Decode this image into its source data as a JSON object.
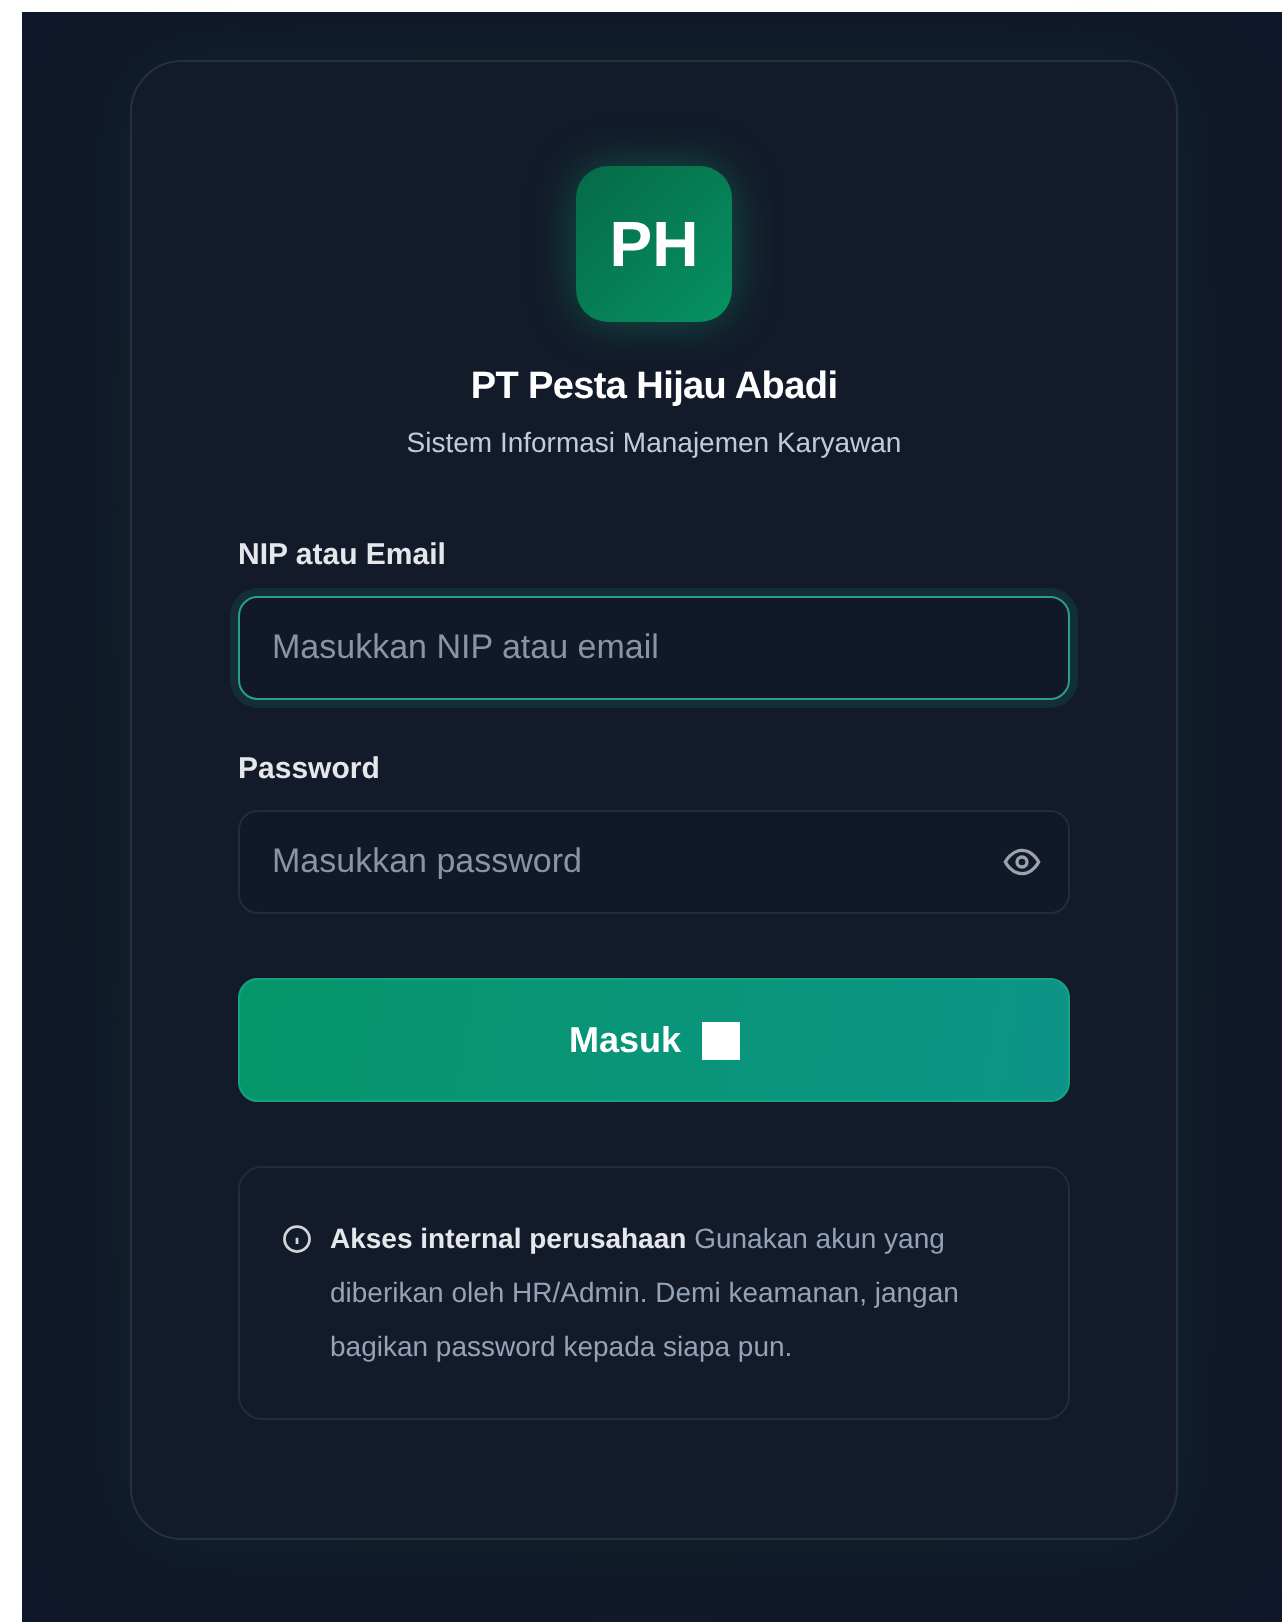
{
  "logo": {
    "initials": "PH"
  },
  "company": "PT Pesta Hijau Abadi",
  "subtitle": "Sistem Informasi Manajemen Karyawan",
  "fields": [
    {
      "label": "NIP atau Email",
      "placeholder": "Masukkan NIP atau email",
      "focused": true,
      "kind": "text"
    },
    {
      "label": "Password",
      "placeholder": "Masukkan password",
      "focused": false,
      "kind": "password"
    }
  ],
  "submit": {
    "label": "Masuk"
  },
  "notice": {
    "text": "**Akses internal perusahaan** Gunakan akun yang diberikan oleh HR/Admin. Demi keamanan, jangan bagikan password kepada siapa pun."
  }
}
